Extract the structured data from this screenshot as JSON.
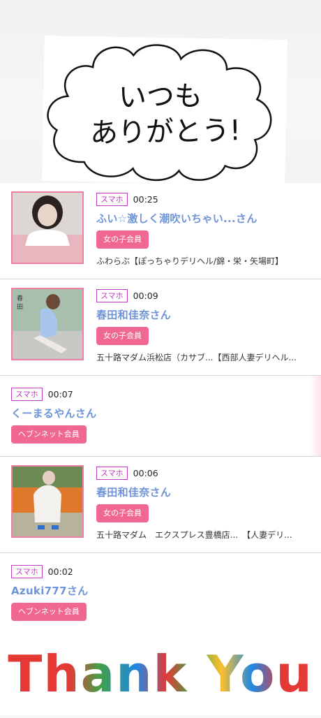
{
  "banner_top": {
    "text_line1": "いつも",
    "text_line2": "ありがとう!"
  },
  "feed": [
    {
      "device": "スマホ",
      "time": "00:25",
      "name": "ふい☆激しく潮吹いちゃい...さん",
      "member": "女の子会員",
      "shop": "ふわらぶ【ぽっちゃりデリヘル/錦・栄・矢場町】",
      "has_thumb": true
    },
    {
      "device": "スマホ",
      "time": "00:09",
      "name": "春田和佳奈さん",
      "member": "女の子会員",
      "shop": "五十路マダム浜松店（カサブ...【西部人妻デリヘル...",
      "has_thumb": true
    },
    {
      "device": "スマホ",
      "time": "00:07",
      "name": "くーまるやんさん",
      "member": "ヘブンネット会員",
      "has_thumb": false
    },
    {
      "device": "スマホ",
      "time": "00:06",
      "name": "春田和佳奈さん",
      "member": "女の子会員",
      "shop": "五十路マダム　エクスプレス豊橋店...　【人妻デリ...",
      "has_thumb": true
    },
    {
      "device": "スマホ",
      "time": "00:02",
      "name": "Azuki777さん",
      "member": "ヘブンネット会員",
      "has_thumb": false
    }
  ],
  "banner_bottom": {
    "text": "Thank You"
  },
  "colors": {
    "accent_pink": "#f06792",
    "link_blue": "#6e94d8",
    "badge_purple": "#c13ac4"
  }
}
